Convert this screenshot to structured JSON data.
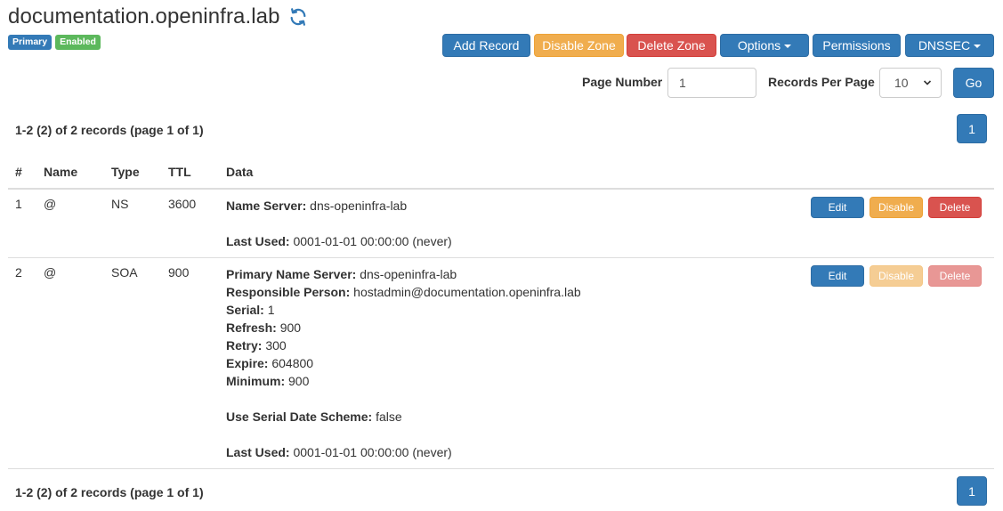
{
  "header": {
    "title": "documentation.openinfra.lab",
    "refresh_icon": "refresh-icon"
  },
  "badges": {
    "type": "Primary",
    "status": "Enabled"
  },
  "toolbar": {
    "add_record": "Add Record",
    "disable_zone": "Disable Zone",
    "delete_zone": "Delete Zone",
    "options": "Options",
    "permissions": "Permissions",
    "dnssec": "DNSSEC"
  },
  "pager": {
    "page_number_label": "Page Number",
    "page_number_value": "1",
    "records_per_page_label": "Records Per Page",
    "records_per_page_value": "10",
    "go": "Go",
    "summary_top": "1-2 (2) of 2 records (page 1 of 1)",
    "summary_bottom": "1-2 (2) of 2 records (page 1 of 1)",
    "current_page": "1"
  },
  "table": {
    "headers": [
      "#",
      "Name",
      "Type",
      "TTL",
      "Data"
    ],
    "rows": [
      {
        "index": "1",
        "name": "@",
        "type": "NS",
        "ttl": "3600",
        "data": [
          {
            "label": "Name Server:",
            "value": "dns-openinfra-lab"
          },
          {
            "label": "",
            "value": ""
          },
          {
            "label": "Last Used:",
            "value": "0001-01-01 00:00:00 (never)"
          }
        ],
        "actions": {
          "edit": "Edit",
          "disable": "Disable",
          "delete": "Delete",
          "enabled": true
        }
      },
      {
        "index": "2",
        "name": "@",
        "type": "SOA",
        "ttl": "900",
        "data": [
          {
            "label": "Primary Name Server:",
            "value": "dns-openinfra-lab"
          },
          {
            "label": "Responsible Person:",
            "value": "hostadmin@documentation.openinfra.lab"
          },
          {
            "label": "Serial:",
            "value": "1"
          },
          {
            "label": "Refresh:",
            "value": "900"
          },
          {
            "label": "Retry:",
            "value": "300"
          },
          {
            "label": "Expire:",
            "value": "604800"
          },
          {
            "label": "Minimum:",
            "value": "900"
          },
          {
            "label": "",
            "value": ""
          },
          {
            "label": "Use Serial Date Scheme:",
            "value": "false"
          },
          {
            "label": "",
            "value": ""
          },
          {
            "label": "Last Used:",
            "value": "0001-01-01 00:00:00 (never)"
          }
        ],
        "actions": {
          "edit": "Edit",
          "disable": "Disable",
          "delete": "Delete",
          "enabled": false
        }
      }
    ]
  },
  "colors": {
    "primary": "#337ab7",
    "warning": "#f0ad4e",
    "danger": "#d9534f",
    "success": "#5cb85c"
  }
}
